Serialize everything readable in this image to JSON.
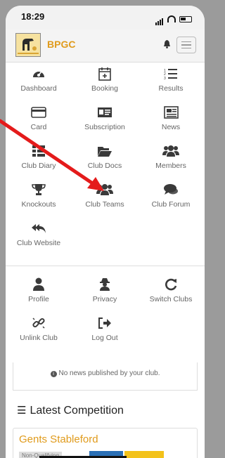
{
  "status": {
    "time": "18:29"
  },
  "appbar": {
    "brand": "BPGC"
  },
  "menu": [
    {
      "label": "Dashboard",
      "icon": "dashboard-icon",
      "glyph": "◕"
    },
    {
      "label": "Booking",
      "icon": "calendar-plus-icon",
      "glyph": "▣"
    },
    {
      "label": "Results",
      "icon": "list-ordered-icon",
      "glyph": "☰"
    },
    {
      "label": "Card",
      "icon": "credit-card-icon",
      "glyph": "▭"
    },
    {
      "label": "Subscription",
      "icon": "id-card-icon",
      "glyph": "▤"
    },
    {
      "label": "News",
      "icon": "newspaper-icon",
      "glyph": "▦"
    },
    {
      "label": "Club Diary",
      "icon": "list-icon",
      "glyph": "☷"
    },
    {
      "label": "Club Docs",
      "icon": "folder-open-icon",
      "glyph": "▰"
    },
    {
      "label": "Members",
      "icon": "users-icon",
      "glyph": "●●"
    },
    {
      "label": "Knockouts",
      "icon": "trophy-icon",
      "glyph": "♜"
    },
    {
      "label": "Club Teams",
      "icon": "users-icon",
      "glyph": "●●"
    },
    {
      "label": "Club Forum",
      "icon": "comments-icon",
      "glyph": "●"
    },
    {
      "label": "Club Website",
      "icon": "reply-all-icon",
      "glyph": "↶"
    }
  ],
  "account": [
    {
      "label": "Profile",
      "icon": "user-icon",
      "glyph": "●"
    },
    {
      "label": "Privacy",
      "icon": "user-secret-icon",
      "glyph": "♟"
    },
    {
      "label": "Switch Clubs",
      "icon": "refresh-icon",
      "glyph": "↻"
    },
    {
      "label": "Unlink Club",
      "icon": "chain-broken-icon",
      "glyph": "⛓"
    },
    {
      "label": "Log Out",
      "icon": "sign-out-icon",
      "glyph": "➜"
    }
  ],
  "news": {
    "message": "No news published by your club."
  },
  "competition": {
    "heading": "Latest Competition",
    "name": "Gents Stableford",
    "tag": "Non-Qualifying"
  },
  "colors": {
    "brand": "#e09b1c",
    "annotation_arrow": "#e41b1b"
  }
}
